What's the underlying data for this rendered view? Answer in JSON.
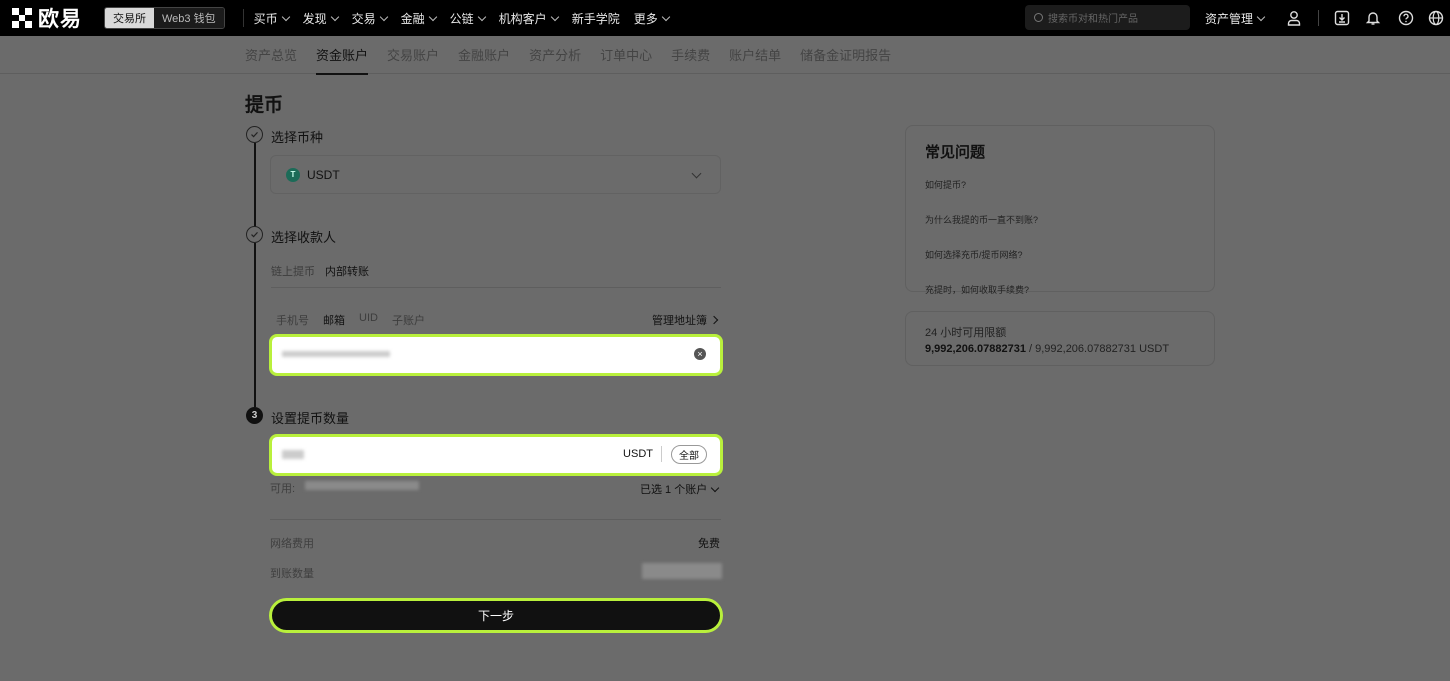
{
  "topbar": {
    "logo_text": "欧易",
    "switch": [
      "交易所",
      "Web3 钱包"
    ],
    "nav": [
      {
        "label": "买币",
        "caret": true
      },
      {
        "label": "发现",
        "caret": true
      },
      {
        "label": "交易",
        "caret": true
      },
      {
        "label": "金融",
        "caret": true
      },
      {
        "label": "公链",
        "caret": true
      },
      {
        "label": "机构客户",
        "caret": true
      },
      {
        "label": "新手学院",
        "caret": false
      },
      {
        "label": "更多",
        "caret": true
      }
    ],
    "search_placeholder": "搜索币对和热门产品",
    "asset_menu": "资产管理",
    "icons": [
      "user-icon",
      "download-icon",
      "bell-icon",
      "help-icon",
      "globe-icon"
    ]
  },
  "subnav": {
    "items": [
      "资产总览",
      "资金账户",
      "交易账户",
      "金融账户",
      "资产分析",
      "订单中心",
      "手续费",
      "账户结单",
      "储备金证明报告"
    ],
    "active_index": 1
  },
  "page_title": "提币",
  "step1": {
    "label": "选择币种",
    "coin": "USDT",
    "coin_icon": "T"
  },
  "step2": {
    "label": "选择收款人",
    "tabs": [
      "链上提币",
      "内部转账"
    ],
    "active_tab": 1,
    "subtabs": [
      "手机号",
      "邮箱",
      "UID",
      "子账户"
    ],
    "active_subtab": 1,
    "address_book": "管理地址簿"
  },
  "step3": {
    "number": "3",
    "label": "设置提币数量",
    "unit": "USDT",
    "all_button": "全部",
    "available_label": "可用:",
    "selected_accounts": "已选 1 个账户",
    "fee_label": "网络费用",
    "fee_value": "免费",
    "receive_label": "到账数量"
  },
  "next_button": "下一步",
  "faq": {
    "title": "常见问题",
    "items": [
      "如何提币?",
      "为什么我提的币一直不到账?",
      "如何选择充币/提币网络?",
      "充提时，如何收取手续费?"
    ]
  },
  "limit": {
    "label": "24 小时可用限额",
    "value": "9,992,206.07882731",
    "total": " / 9,992,206.07882731 USDT"
  },
  "colors": {
    "highlight": "#b9f03c",
    "overlay_bg": "#6b6b6b",
    "topbar": "#000000",
    "coin": "#1c6b58"
  }
}
